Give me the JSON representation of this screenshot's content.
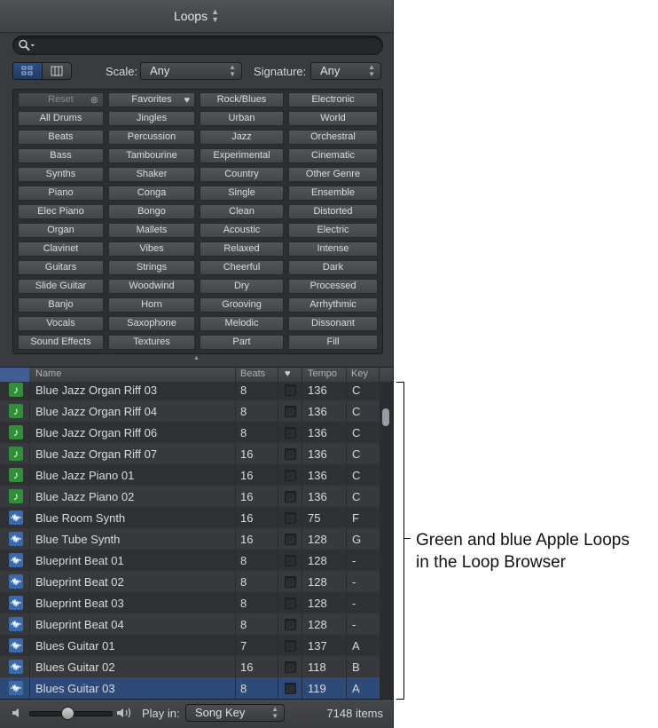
{
  "panel": {
    "title": "Loops",
    "search": {
      "value": "",
      "placeholder": ""
    },
    "filters": {
      "scale_label": "Scale:",
      "scale_value": "Any",
      "signature_label": "Signature:",
      "signature_value": "Any"
    },
    "keywords": [
      [
        "Reset",
        "Favorites",
        "Rock/Blues",
        "Electronic"
      ],
      [
        "All Drums",
        "Jingles",
        "Urban",
        "World"
      ],
      [
        "Beats",
        "Percussion",
        "Jazz",
        "Orchestral"
      ],
      [
        "Bass",
        "Tambourine",
        "Experimental",
        "Cinematic"
      ],
      [
        "Synths",
        "Shaker",
        "Country",
        "Other Genre"
      ],
      [
        "Piano",
        "Conga",
        "Single",
        "Ensemble"
      ],
      [
        "Elec Piano",
        "Bongo",
        "Clean",
        "Distorted"
      ],
      [
        "Organ",
        "Mallets",
        "Acoustic",
        "Electric"
      ],
      [
        "Clavinet",
        "Vibes",
        "Relaxed",
        "Intense"
      ],
      [
        "Guitars",
        "Strings",
        "Cheerful",
        "Dark"
      ],
      [
        "Slide Guitar",
        "Woodwind",
        "Dry",
        "Processed"
      ],
      [
        "Banjo",
        "Horn",
        "Grooving",
        "Arrhythmic"
      ],
      [
        "Vocals",
        "Saxophone",
        "Melodic",
        "Dissonant"
      ],
      [
        "Sound Effects",
        "Textures",
        "Part",
        "Fill"
      ]
    ],
    "table": {
      "columns": {
        "name": "Name",
        "beats": "Beats",
        "tempo": "Tempo",
        "key": "Key"
      },
      "rows": [
        {
          "type": "green",
          "name": "Blue Jazz Organ Riff 03",
          "beats": "8",
          "tempo": "136",
          "key": "C"
        },
        {
          "type": "green",
          "name": "Blue Jazz Organ Riff 04",
          "beats": "8",
          "tempo": "136",
          "key": "C"
        },
        {
          "type": "green",
          "name": "Blue Jazz Organ Riff 06",
          "beats": "8",
          "tempo": "136",
          "key": "C"
        },
        {
          "type": "green",
          "name": "Blue Jazz Organ Riff 07",
          "beats": "16",
          "tempo": "136",
          "key": "C"
        },
        {
          "type": "green",
          "name": "Blue Jazz Piano 01",
          "beats": "16",
          "tempo": "136",
          "key": "C"
        },
        {
          "type": "green",
          "name": "Blue Jazz Piano 02",
          "beats": "16",
          "tempo": "136",
          "key": "C"
        },
        {
          "type": "blue",
          "name": "Blue Room Synth",
          "beats": "16",
          "tempo": "75",
          "key": "F"
        },
        {
          "type": "blue",
          "name": "Blue Tube Synth",
          "beats": "16",
          "tempo": "128",
          "key": "G"
        },
        {
          "type": "blue",
          "name": "Blueprint Beat 01",
          "beats": "8",
          "tempo": "128",
          "key": "-"
        },
        {
          "type": "blue",
          "name": "Blueprint Beat 02",
          "beats": "8",
          "tempo": "128",
          "key": "-"
        },
        {
          "type": "blue",
          "name": "Blueprint Beat 03",
          "beats": "8",
          "tempo": "128",
          "key": "-"
        },
        {
          "type": "blue",
          "name": "Blueprint Beat 04",
          "beats": "8",
          "tempo": "128",
          "key": "-"
        },
        {
          "type": "blue",
          "name": "Blues Guitar 01",
          "beats": "7",
          "tempo": "137",
          "key": "A"
        },
        {
          "type": "blue",
          "name": "Blues Guitar 02",
          "beats": "16",
          "tempo": "118",
          "key": "B"
        },
        {
          "type": "blue",
          "name": "Blues Guitar 03",
          "beats": "8",
          "tempo": "119",
          "key": "A"
        }
      ],
      "selected_row": 14
    },
    "footer": {
      "volume": 0.45,
      "play_in_label": "Play in:",
      "play_in_value": "Song Key",
      "item_count": "7148 items"
    }
  },
  "annotation": {
    "line1": "Green and blue Apple Loops",
    "line2": "in the Loop Browser"
  },
  "colors": {
    "green_loop": "#2f8f3a",
    "blue_loop": "#3a6aa8",
    "selection": "#2e4a78",
    "row_dark": "#303134",
    "row_light": "#38393c"
  },
  "icons": {
    "reset": "x-circle-icon",
    "favorites": "heart-icon",
    "search": "magnifier-icon",
    "green_loop": "music-note-icon",
    "blue_loop": "waveform-icon"
  }
}
